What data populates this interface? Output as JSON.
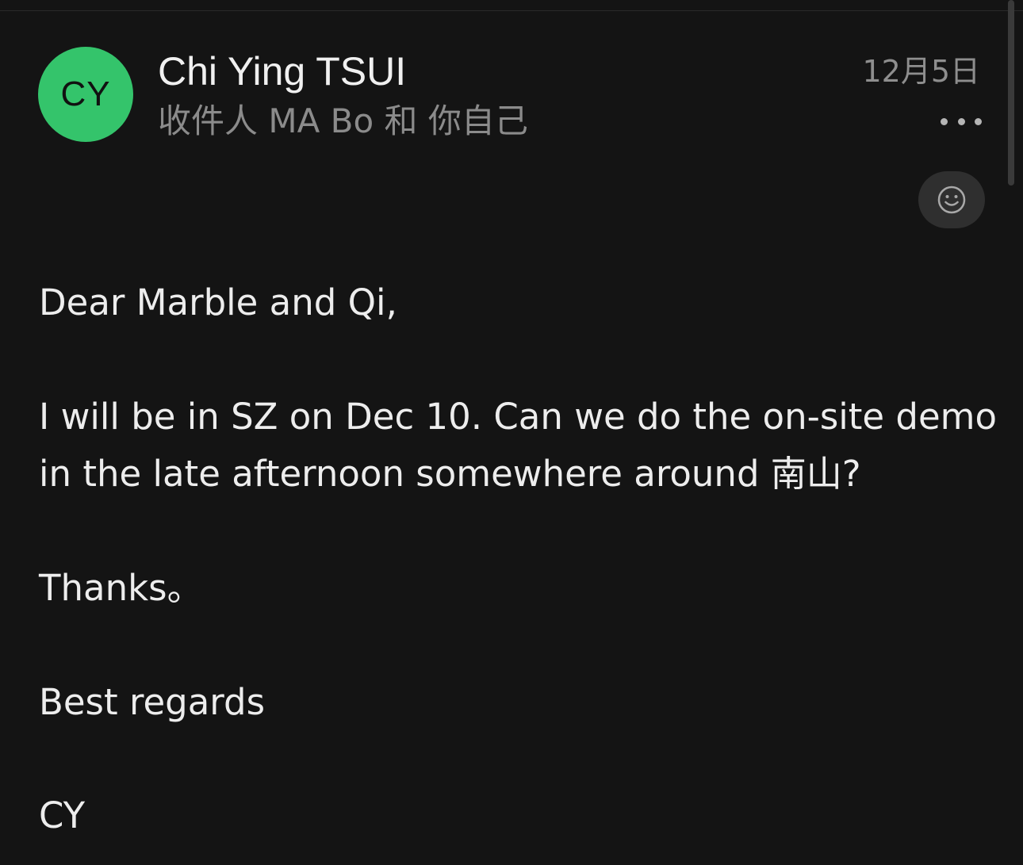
{
  "header": {
    "avatar_initials": "CY",
    "avatar_color": "#34c46b",
    "sender_name": "Chi Ying TSUI",
    "recipients": "收件人 MA Bo 和 你自己",
    "date": "12月5日",
    "more_icon": "more-horizontal-icon",
    "reaction_icon": "smiley-icon"
  },
  "message": {
    "greeting": "Dear Marble and Qi,",
    "line1": "I will be in SZ on Dec 10. Can we do the on-site demo",
    "line2": "in the late afternoon somewhere around 南山?",
    "thanks": "Thanks。",
    "closing": "Best regards",
    "signature": "CY"
  }
}
